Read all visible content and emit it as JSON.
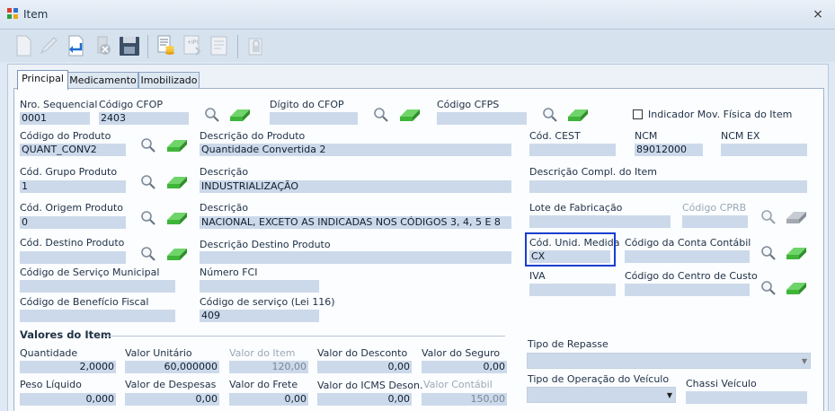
{
  "window": {
    "title": "Item",
    "close": "⨯"
  },
  "tabs": [
    {
      "label": "Principal"
    },
    {
      "label": "Medicamento"
    },
    {
      "label": "Imobilizado"
    }
  ],
  "form": {
    "nro_sequencial": {
      "label": "Nro. Sequencial",
      "value": "0001"
    },
    "codigo_cfop": {
      "label": "Código CFOP",
      "value": "2403"
    },
    "digito_cfop": {
      "label": "Dígito do CFOP",
      "value": ""
    },
    "codigo_cfps": {
      "label": "Código CFPS",
      "value": ""
    },
    "indicador_mov": {
      "label": "Indicador Mov. Física do Item",
      "checked": false
    },
    "codigo_produto": {
      "label": "Código do Produto",
      "value": "QUANT_CONV2"
    },
    "descricao_produto": {
      "label": "Descrição do Produto",
      "value": "Quantidade Convertida 2"
    },
    "cod_cest": {
      "label": "Cód. CEST",
      "value": ""
    },
    "ncm": {
      "label": "NCM",
      "value": "89012000"
    },
    "ncm_ex": {
      "label": "NCM EX",
      "value": ""
    },
    "cod_grupo": {
      "label": "Cód. Grupo Produto",
      "value": "1"
    },
    "descricao_grupo": {
      "label": "Descrição",
      "value": "INDUSTRIALIZAÇÃO"
    },
    "descricao_compl": {
      "label": "Descrição Compl. do Item",
      "value": ""
    },
    "cod_origem": {
      "label": "Cód. Origem Produto",
      "value": "0"
    },
    "descricao_origem": {
      "label": "Descrição",
      "value": "NACIONAL, EXCETO AS INDICADAS NOS CÓDIGOS 3, 4, 5 E 8"
    },
    "lote": {
      "label": "Lote de Fabricação",
      "value": ""
    },
    "codigo_cprb": {
      "label": "Código CPRB",
      "value": ""
    },
    "cod_destino": {
      "label": "Cód. Destino Produto",
      "value": ""
    },
    "descricao_destino": {
      "label": "Descrição Destino Produto",
      "value": ""
    },
    "cod_unid": {
      "label": "Cód. Unid. Medida",
      "value": "CX"
    },
    "conta_contabil": {
      "label": "Código da Conta Contábil",
      "value": ""
    },
    "servico_municipal": {
      "label": "Código de Serviço Municipal",
      "value": ""
    },
    "numero_fci": {
      "label": "Número FCI",
      "value": ""
    },
    "iva": {
      "label": "IVA",
      "value": ""
    },
    "centro_custo": {
      "label": "Código do Centro de Custo",
      "value": ""
    },
    "beneficio_fiscal": {
      "label": "Código de Benefício Fiscal",
      "value": ""
    },
    "codigo_servico": {
      "label": "Código de serviço (Lei 116)",
      "value": "409"
    }
  },
  "valores": {
    "group_title": "Valores do Item",
    "quantidade": {
      "label": "Quantidade",
      "value": "2,0000"
    },
    "valor_unitario": {
      "label": "Valor Unitário",
      "value": "60,000000"
    },
    "valor_item": {
      "label": "Valor do Item",
      "value": "120,00"
    },
    "valor_desconto": {
      "label": "Valor do Desconto",
      "value": "0,00"
    },
    "valor_seguro": {
      "label": "Valor do Seguro",
      "value": "0,00"
    },
    "peso_liquido": {
      "label": "Peso Líquido",
      "value": "0,000"
    },
    "valor_despesas": {
      "label": "Valor de Despesas",
      "value": "0,00"
    },
    "valor_frete": {
      "label": "Valor do  Frete",
      "value": "0,00"
    },
    "valor_icms_deson": {
      "label": "Valor do ICMS Deson.",
      "value": "0,00"
    },
    "valor_contabil": {
      "label": "Valor Contábil",
      "value": "150,00"
    }
  },
  "right_bottom": {
    "tipo_repasse": {
      "label": "Tipo de Repasse",
      "value": ""
    },
    "tipo_operacao": {
      "label": "Tipo de Operação do Veículo",
      "value": ""
    },
    "chassi": {
      "label": "Chassi Veículo",
      "value": ""
    }
  },
  "colors": {
    "field_bg": "#ccd9ea",
    "highlight": "#1a3ecf",
    "eraser_green": "#3fb53a"
  }
}
